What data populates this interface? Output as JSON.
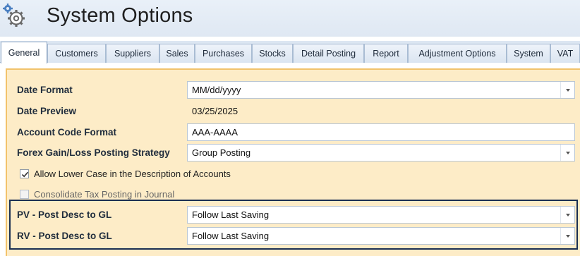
{
  "window": {
    "title": "System Options",
    "icon": "gear-icon"
  },
  "tabs": [
    {
      "label": "General",
      "active": true
    },
    {
      "label": "Customers",
      "active": false
    },
    {
      "label": "Suppliers",
      "active": false
    },
    {
      "label": "Sales",
      "active": false
    },
    {
      "label": "Purchases",
      "active": false
    },
    {
      "label": "Stocks",
      "active": false
    },
    {
      "label": "Detail Posting",
      "active": false
    },
    {
      "label": "Report",
      "active": false
    },
    {
      "label": "Adjustment Options",
      "active": false
    },
    {
      "label": "System",
      "active": false
    },
    {
      "label": "VAT",
      "active": false
    }
  ],
  "general": {
    "date_format": {
      "label": "Date Format",
      "value": "MM/dd/yyyy"
    },
    "date_preview": {
      "label": "Date Preview",
      "value": "03/25/2025"
    },
    "account_code_format": {
      "label": "Account Code Format",
      "value": "AAA-AAAA"
    },
    "forex_strategy": {
      "label": "Forex Gain/Loss Posting Strategy",
      "value": "Group Posting"
    },
    "allow_lower_case": {
      "label": "Allow Lower Case in the Description of Accounts",
      "checked": true
    },
    "consolidate_tax": {
      "label": "Consolidate Tax Posting in Journal",
      "checked": false,
      "enabled": false
    },
    "pv_post_desc": {
      "label": "PV - Post Desc to GL",
      "value": "Follow Last Saving"
    },
    "rv_post_desc": {
      "label": "RV - Post Desc to GL",
      "value": "Follow Last Saving"
    }
  },
  "colors": {
    "panel_bg": "#fdecc7",
    "tab_strip": "#dce6f2",
    "highlight_border": "#1b2f52"
  }
}
